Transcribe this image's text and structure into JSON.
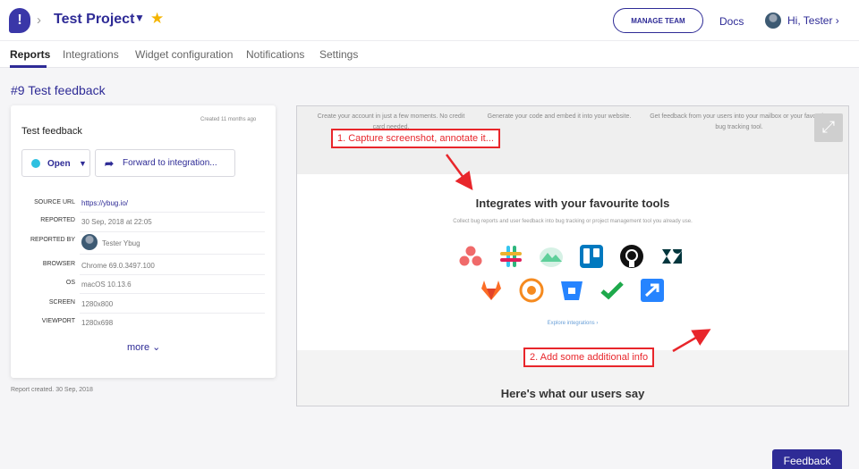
{
  "header": {
    "logo_glyph": "!",
    "breadcrumb_separator": "›",
    "project_title": "Test Project",
    "manage_team_label": "MANAGE TEAM",
    "docs_label": "Docs",
    "user_greeting": "Hi, Tester"
  },
  "tabs": [
    {
      "label": "Reports",
      "active": true
    },
    {
      "label": "Integrations",
      "active": false
    },
    {
      "label": "Widget configuration",
      "active": false
    },
    {
      "label": "Notifications",
      "active": false
    },
    {
      "label": "Settings",
      "active": false
    }
  ],
  "report": {
    "title": "#9 Test feedback",
    "card_title": "Test feedback",
    "created_ago": "Created 11 months ago",
    "status_label": "Open",
    "status_color": "#2ec0e0",
    "forward_label": "Forward to integration...",
    "details": [
      {
        "label": "SOURCE URL",
        "value": "https://ybug.io/",
        "link": true
      },
      {
        "label": "REPORTED",
        "value": "30 Sep, 2018 at 22:05"
      },
      {
        "label": "REPORTED BY",
        "value": "Tester Ybug"
      },
      {
        "label": "BROWSER",
        "value": "Chrome 69.0.3497.100"
      },
      {
        "label": "OS",
        "value": "macOS 10.13.6"
      },
      {
        "label": "SCREEN",
        "value": "1280x800"
      },
      {
        "label": "VIEWPORT",
        "value": "1280x698"
      }
    ],
    "more_label": "more",
    "footer_note": "Report created.  30 Sep, 2018"
  },
  "screenshot": {
    "steps": [
      "Create your account in just a few moments. No credit card needed.",
      "Generate your code and embed it into your website.",
      "Get feedback from your users into your mailbox or your favourite bug tracking tool."
    ],
    "heading": "Integrates with your favourite tools",
    "subheading": "Collect bug reports and user feedback into bug tracking or project management tool you already use.",
    "explore_label": "Explore integrations  ›",
    "bottom_heading": "Here's what our users say",
    "annotations": [
      "1. Capture screenshot, annotate it...",
      "2. Add some additional info"
    ],
    "tools": [
      {
        "name": "asana-icon",
        "color": "#f06a6a"
      },
      {
        "name": "slack-icon",
        "color": "#e01e5a"
      },
      {
        "name": "basecamp-icon",
        "color": "#5ecf9a"
      },
      {
        "name": "trello-icon",
        "color": "#0079bf"
      },
      {
        "name": "github-icon",
        "color": "#111111"
      },
      {
        "name": "zendesk-icon",
        "color": "#03363d"
      },
      {
        "name": "gitlab-icon",
        "color": "#fc6d26"
      },
      {
        "name": "pivotal-icon",
        "color": "#f58a1f"
      },
      {
        "name": "bitbucket-icon",
        "color": "#2684ff"
      },
      {
        "name": "checkmark-tool-icon",
        "color": "#1ea94b"
      },
      {
        "name": "jira-icon",
        "color": "#2684ff"
      }
    ]
  },
  "feedback_label": "Feedback",
  "colors": {
    "brand": "#2e2b96",
    "annotation": "#e8262b",
    "star": "#f4b400"
  }
}
